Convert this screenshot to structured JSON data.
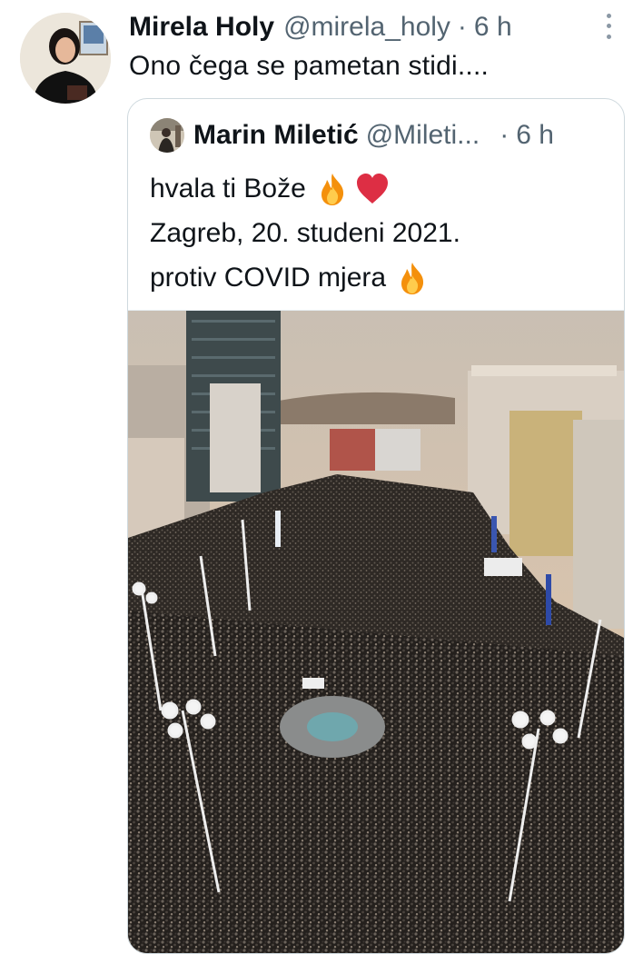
{
  "tweet": {
    "author_name": "Mirela Holy",
    "author_handle": "@mirela_holy",
    "separator": "·",
    "time": "6 h",
    "text": "Ono čega se pametan stidi...."
  },
  "quoted_tweet": {
    "author_name": "Marin Miletić",
    "author_handle": "@Mileti",
    "handle_ellipsis": "...",
    "separator": "·",
    "time": "6 h",
    "lines": [
      "hvala ti Bože",
      "Zagreb, 20. studeni 2021.",
      "protiv COVID mjera"
    ],
    "photo_subject": "aerial crowd photo, Ban Jelačić Square"
  },
  "icons": {
    "more": "more-vertical-icon",
    "fire": "fire-emoji-icon",
    "heart": "red-heart-emoji-icon"
  },
  "colors": {
    "text": "#0f1419",
    "secondary": "#536471",
    "border": "#cfd9de",
    "heart": "#e0245e"
  }
}
